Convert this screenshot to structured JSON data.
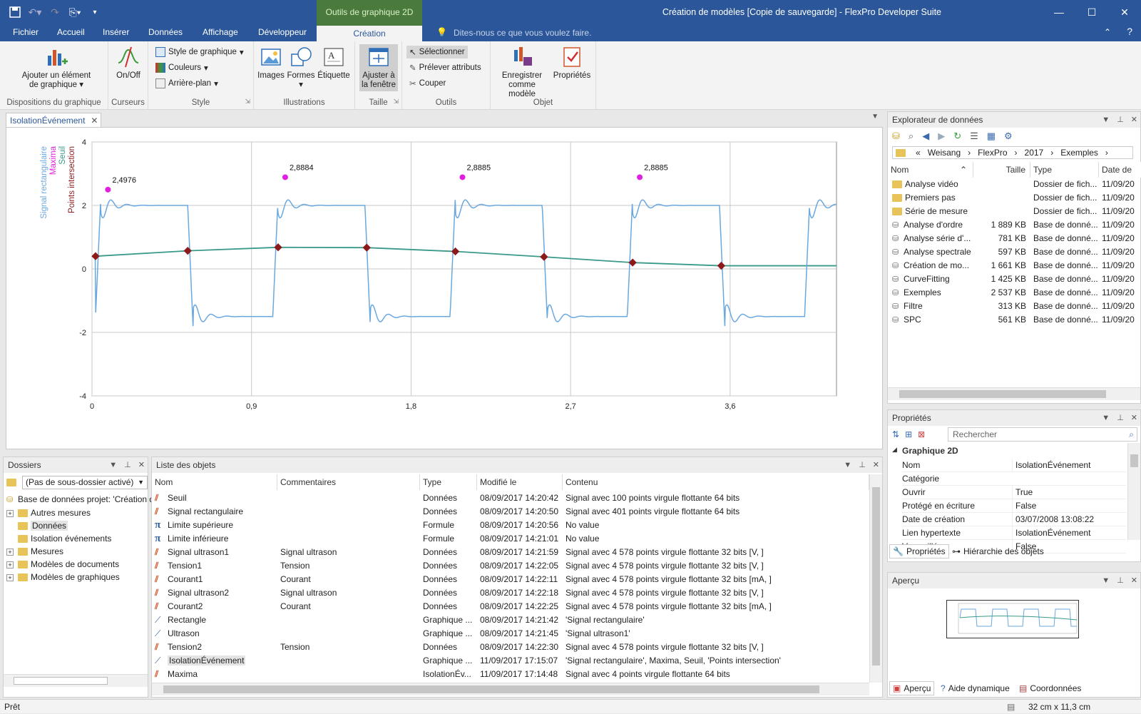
{
  "titlebar": {
    "context_tab": "Outils de graphique 2D",
    "title": "Création de modèles [Copie de sauvegarde] - FlexPro Developer Suite"
  },
  "menu_tabs": [
    "Fichier",
    "Accueil",
    "Insérer",
    "Données",
    "Affichage",
    "Développeur",
    "Création"
  ],
  "tell_me": "Dites-nous ce que vous voulez faire.",
  "ribbon": {
    "add_element": "Ajouter un élément",
    "add_element2": "de graphique",
    "onoff": "On/Off",
    "style_graph": "Style de graphique",
    "colors": "Couleurs",
    "background": "Arrière-plan",
    "images": "Images",
    "shapes": "Formes",
    "label": "Étiquette",
    "fit1": "Ajuster à",
    "fit2": "la fenêtre",
    "select": "Sélectionner",
    "pick_attr": "Prélever attributs",
    "cut": "Couper",
    "save_tpl1": "Enregistrer",
    "save_tpl2": "comme modèle",
    "props": "Propriétés",
    "groups": [
      "Dispositions du graphique",
      "Curseurs",
      "Style",
      "Illustrations",
      "Taille",
      "Outils",
      "Objet"
    ]
  },
  "doc_tab": "IsolationÉvénement",
  "chart_data": {
    "type": "line",
    "legend": [
      "Signal rectangulaire",
      "Maxima",
      "Seuil",
      "Points intersection"
    ],
    "legend_colors": [
      "#6aa8e0",
      "#e020e0",
      "#3a9a8a",
      "#8b1a1a"
    ],
    "xticks": [
      "0",
      "0,9",
      "1,8",
      "2,7",
      "3,6"
    ],
    "yticks": [
      "4",
      "2",
      "0",
      "-2",
      "-4"
    ],
    "xlim": [
      0,
      4.2
    ],
    "ylim": [
      -4,
      4
    ],
    "maxima": [
      {
        "x": 0.09,
        "y": 2.4976,
        "label": "2,4976"
      },
      {
        "x": 1.09,
        "y": 2.8884,
        "label": "2,8884"
      },
      {
        "x": 2.09,
        "y": 2.8885,
        "label": "2,8885"
      },
      {
        "x": 3.09,
        "y": 2.8885,
        "label": "2,8885"
      }
    ],
    "intersections": [
      {
        "x": 0.02,
        "y": 0.4
      },
      {
        "x": 0.54,
        "y": 0.57
      },
      {
        "x": 1.05,
        "y": 0.68
      },
      {
        "x": 1.55,
        "y": 0.67
      },
      {
        "x": 2.05,
        "y": 0.55
      },
      {
        "x": 2.55,
        "y": 0.38
      },
      {
        "x": 3.05,
        "y": 0.2
      },
      {
        "x": 3.55,
        "y": 0.1
      }
    ]
  },
  "explorer": {
    "title": "Explorateur de données",
    "path": [
      "«",
      "Weisang",
      "FlexPro",
      "2017",
      "Exemples"
    ],
    "cols": [
      "Nom",
      "Taille",
      "Type",
      "Date de"
    ],
    "rows": [
      {
        "name": "Analyse vidéo",
        "size": "",
        "type": "Dossier de fich...",
        "date": "11/09/20",
        "kind": "folder"
      },
      {
        "name": "Premiers pas",
        "size": "",
        "type": "Dossier de fich...",
        "date": "11/09/20",
        "kind": "folder"
      },
      {
        "name": "Série de mesure",
        "size": "",
        "type": "Dossier de fich...",
        "date": "11/09/20",
        "kind": "folder"
      },
      {
        "name": "Analyse d'ordre",
        "size": "1 889 KB",
        "type": "Base de donné...",
        "date": "11/09/20",
        "kind": "db"
      },
      {
        "name": "Analyse série d'...",
        "size": "781 KB",
        "type": "Base de donné...",
        "date": "11/09/20",
        "kind": "db"
      },
      {
        "name": "Analyse spectrale",
        "size": "597 KB",
        "type": "Base de donné...",
        "date": "11/09/20",
        "kind": "db"
      },
      {
        "name": "Création de mo...",
        "size": "1 661 KB",
        "type": "Base de donné...",
        "date": "11/09/20",
        "kind": "db"
      },
      {
        "name": "CurveFitting",
        "size": "1 425 KB",
        "type": "Base de donné...",
        "date": "11/09/20",
        "kind": "db"
      },
      {
        "name": "Exemples",
        "size": "2 537 KB",
        "type": "Base de donné...",
        "date": "11/09/20",
        "kind": "db"
      },
      {
        "name": "Filtre",
        "size": "313 KB",
        "type": "Base de donné...",
        "date": "11/09/20",
        "kind": "db"
      },
      {
        "name": "SPC",
        "size": "561 KB",
        "type": "Base de donné...",
        "date": "11/09/20",
        "kind": "db"
      }
    ]
  },
  "props": {
    "title": "Propriétés",
    "search": "Rechercher",
    "section": "Graphique 2D",
    "rows": [
      {
        "k": "Nom",
        "v": "IsolationÉvénement"
      },
      {
        "k": "Catégorie",
        "v": ""
      },
      {
        "k": "Ouvrir",
        "v": "True"
      },
      {
        "k": "Protégé en écriture",
        "v": "False"
      },
      {
        "k": "Date de création",
        "v": "03/07/2008 13:08:22"
      },
      {
        "k": "Lien hypertexte",
        "v": "IsolationÉvénement"
      },
      {
        "k": "Verrouillé",
        "v": "False"
      }
    ],
    "tab1": "Propriétés",
    "tab2": "Hiérarchie des objets"
  },
  "preview": {
    "title": "Aperçu",
    "tab1": "Aperçu",
    "tab2": "Aide dynamique",
    "tab3": "Coordonnées"
  },
  "folders": {
    "title": "Dossiers",
    "combo": "(Pas de sous-dossier activé)",
    "root": "Base de données projet: 'Création de",
    "items": [
      {
        "label": "Autres mesures",
        "expand": true,
        "sel": false
      },
      {
        "label": "Données",
        "expand": false,
        "sel": true
      },
      {
        "label": "Isolation événements",
        "expand": false,
        "sel": false
      },
      {
        "label": "Mesures",
        "expand": true,
        "sel": false
      },
      {
        "label": "Modèles de documents",
        "expand": true,
        "sel": false
      },
      {
        "label": "Modèles de graphiques",
        "expand": true,
        "sel": false
      }
    ]
  },
  "objects": {
    "title": "Liste des objets",
    "cols": [
      "Nom",
      "Commentaires",
      "Type",
      "Modifié le",
      "Contenu"
    ],
    "rows": [
      {
        "n": "Seuil",
        "c": "",
        "t": "Données",
        "m": "08/09/2017 14:20:42",
        "x": "Signal avec 100 points virgule flottante 64 bits",
        "i": "sig"
      },
      {
        "n": "Signal rectangulaire",
        "c": "",
        "t": "Données",
        "m": "08/09/2017 14:20:50",
        "x": "Signal avec 401 points virgule flottante 64 bits",
        "i": "sig"
      },
      {
        "n": "Limite supérieure",
        "c": "",
        "t": "Formule",
        "m": "08/09/2017 14:20:56",
        "x": "No value",
        "i": "pi"
      },
      {
        "n": "Limite inférieure",
        "c": "",
        "t": "Formule",
        "m": "08/09/2017 14:21:01",
        "x": "No value",
        "i": "pi"
      },
      {
        "n": "Signal ultrason1",
        "c": "Signal ultrason",
        "t": "Données",
        "m": "08/09/2017 14:21:59",
        "x": "Signal avec 4 578 points virgule flottante 32 bits [V, ]",
        "i": "sig"
      },
      {
        "n": "Tension1",
        "c": "Tension",
        "t": "Données",
        "m": "08/09/2017 14:22:05",
        "x": "Signal avec 4 578 points virgule flottante 32 bits [V, ]",
        "i": "sig"
      },
      {
        "n": "Courant1",
        "c": "Courant",
        "t": "Données",
        "m": "08/09/2017 14:22:11",
        "x": "Signal avec 4 578 points virgule flottante 32 bits [mA, ]",
        "i": "sig"
      },
      {
        "n": "Signal ultrason2",
        "c": "Signal ultrason",
        "t": "Données",
        "m": "08/09/2017 14:22:18",
        "x": "Signal avec 4 578 points virgule flottante 32 bits [V, ]",
        "i": "sig"
      },
      {
        "n": "Courant2",
        "c": "Courant",
        "t": "Données",
        "m": "08/09/2017 14:22:25",
        "x": "Signal avec 4 578 points virgule flottante 32 bits [mA, ]",
        "i": "sig"
      },
      {
        "n": "Rectangle",
        "c": "",
        "t": "Graphique ...",
        "m": "08/09/2017 14:21:42",
        "x": "'Signal rectangulaire'",
        "i": "graph"
      },
      {
        "n": "Ultrason",
        "c": "",
        "t": "Graphique ...",
        "m": "08/09/2017 14:21:45",
        "x": "'Signal ultrason1'",
        "i": "graph"
      },
      {
        "n": "Tension2",
        "c": "Tension",
        "t": "Données",
        "m": "08/09/2017 14:22:30",
        "x": "Signal avec 4 578 points virgule flottante 32 bits [V, ]",
        "i": "sig"
      },
      {
        "n": "IsolationÉvénement",
        "c": "",
        "t": "Graphique ...",
        "m": "11/09/2017 17:15:07",
        "x": "'Signal rectangulaire', Maxima, Seuil, 'Points intersection'",
        "i": "graph"
      },
      {
        "n": "Maxima",
        "c": "",
        "t": "IsolationÉv...",
        "m": "11/09/2017 17:14:48",
        "x": "Signal avec 4 points virgule flottante 64 bits",
        "i": "sig"
      }
    ]
  },
  "status": {
    "left": "Prêt",
    "right": "32 cm x 11,3 cm"
  }
}
